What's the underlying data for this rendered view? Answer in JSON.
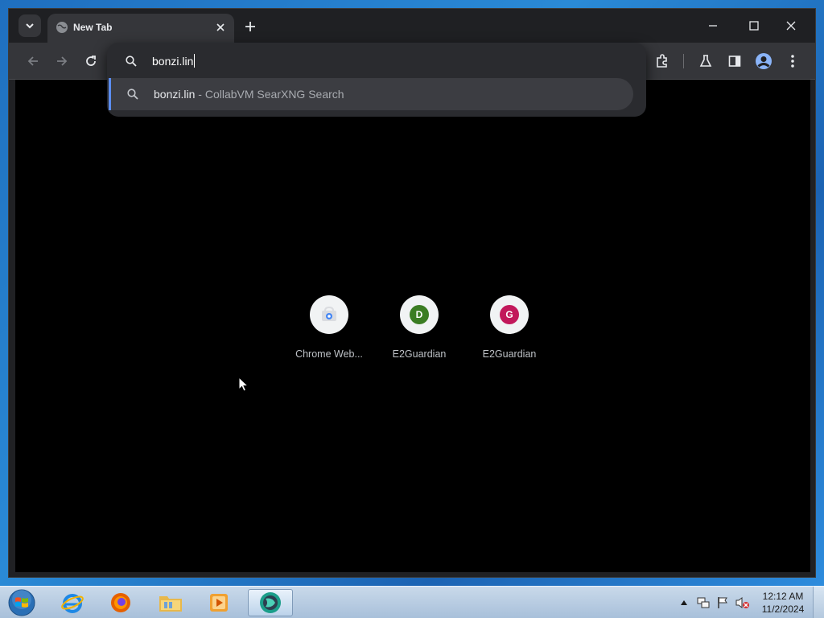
{
  "browser": {
    "tab": {
      "title": "New Tab"
    },
    "omnibox": {
      "typed_text": "bonzi.lin",
      "suggestion": {
        "query": "bonzi.lin",
        "separator": " - ",
        "description": "CollabVM SearXNG Search"
      }
    },
    "shortcuts": [
      {
        "label": "Chrome Web...",
        "icon": "chrome-web-store-icon"
      },
      {
        "label": "E2Guardian",
        "letter": "D",
        "color": "#3b7d23"
      },
      {
        "label": "E2Guardian",
        "letter": "G",
        "color": "#c2185b"
      }
    ]
  },
  "taskbar": {
    "apps": [
      {
        "name": "internet-explorer",
        "icon": "ie-icon"
      },
      {
        "name": "firefox",
        "icon": "firefox-icon"
      },
      {
        "name": "windows-explorer",
        "icon": "folder-icon"
      },
      {
        "name": "media-player",
        "icon": "media-player-icon"
      },
      {
        "name": "chrome-active",
        "icon": "browser-icon"
      }
    ],
    "clock": {
      "time": "12:12 AM",
      "date": "11/2/2024"
    }
  },
  "colors": {
    "accent": "#5b8df0",
    "toolbar": "#35363a",
    "page": "#000000"
  }
}
